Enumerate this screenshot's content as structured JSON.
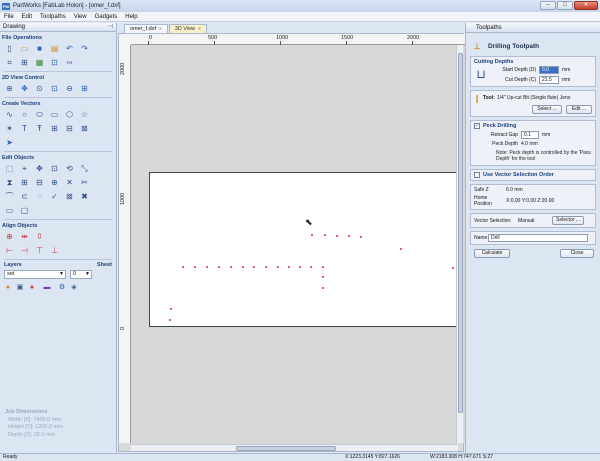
{
  "app": {
    "title": "PartWorks [FabLab Holon] - [omer_f.dxf]",
    "icon_text": "PW"
  },
  "window_buttons": {
    "minimize": "–",
    "maximize": "□",
    "close": "✕"
  },
  "menu": [
    "File",
    "Edit",
    "Toolpaths",
    "View",
    "Gadgets",
    "Help"
  ],
  "left_panel": {
    "header": "Drawing",
    "sections": {
      "file_operations": "File Operations",
      "view_control": "2D View Control",
      "create_vectors": "Create Vectors",
      "edit_objects": "Edit Objects",
      "align_objects": "Align Objects"
    },
    "layers_label": "Layers",
    "sheet_label": "Sheet",
    "layer_value": "set",
    "sheet_value": "0",
    "job_dimensions": {
      "title": "Job Dimensions",
      "width": "Width  [X]: 7400.0 mm",
      "height": "Height [Y]: 1200.0 mm",
      "depth": "Depth  [Z]: 25.0 mm"
    }
  },
  "tabs": [
    {
      "label": "omer_f.dxf",
      "close": "x"
    },
    {
      "label": "3D View",
      "close": "x"
    }
  ],
  "rulers": {
    "top": [
      "0",
      "500",
      "1000",
      "1500",
      "2000"
    ],
    "left": [
      "2000",
      "1000",
      "0"
    ]
  },
  "right_panel": {
    "header": "Toolpaths",
    "title": "Drilling Toolpath",
    "cutting_depths": {
      "title": "Cutting Depths",
      "start_depth_label": "Start Depth (D)",
      "start_depth_value": "0.0",
      "cut_depth_label": "Cut Depth (C)",
      "cut_depth_value": "21.5",
      "unit": "mm"
    },
    "tool": {
      "label": "Tool:",
      "value": "1/4\" Up-cut Bit (Single flute) Jens",
      "select": "Select ...",
      "edit": "Edit ..."
    },
    "peck": {
      "label": "Peck Drilling",
      "checked": "✓",
      "retract_label": "Retract Gap",
      "retract_value": "0.1",
      "retract_unit": "mm",
      "peck_depth_label": "Peck Depth",
      "peck_depth_value": "4.0 mm",
      "note": "Note: Peck depth is controlled by the 'Pass Depth' for the tool"
    },
    "vector_order": {
      "label": "Use Vector Selection Order"
    },
    "safe_z": {
      "label": "Safe Z",
      "value": "6.0 mm"
    },
    "home": {
      "label": "Home Position",
      "value": "X:0.00 Y:0.00 Z:20.00"
    },
    "vector_selection": {
      "label": "Vector Selection:",
      "value": "Manual",
      "button": "Selector ..."
    },
    "name": {
      "label": "Name:",
      "value": "Drill"
    },
    "calculate": "Calculate",
    "close": "Close"
  },
  "status": {
    "ready": "Ready",
    "coords": "X:1223.3145 Y:827.1626",
    "size": "W:2183.308   H:747.671   S:27"
  }
}
